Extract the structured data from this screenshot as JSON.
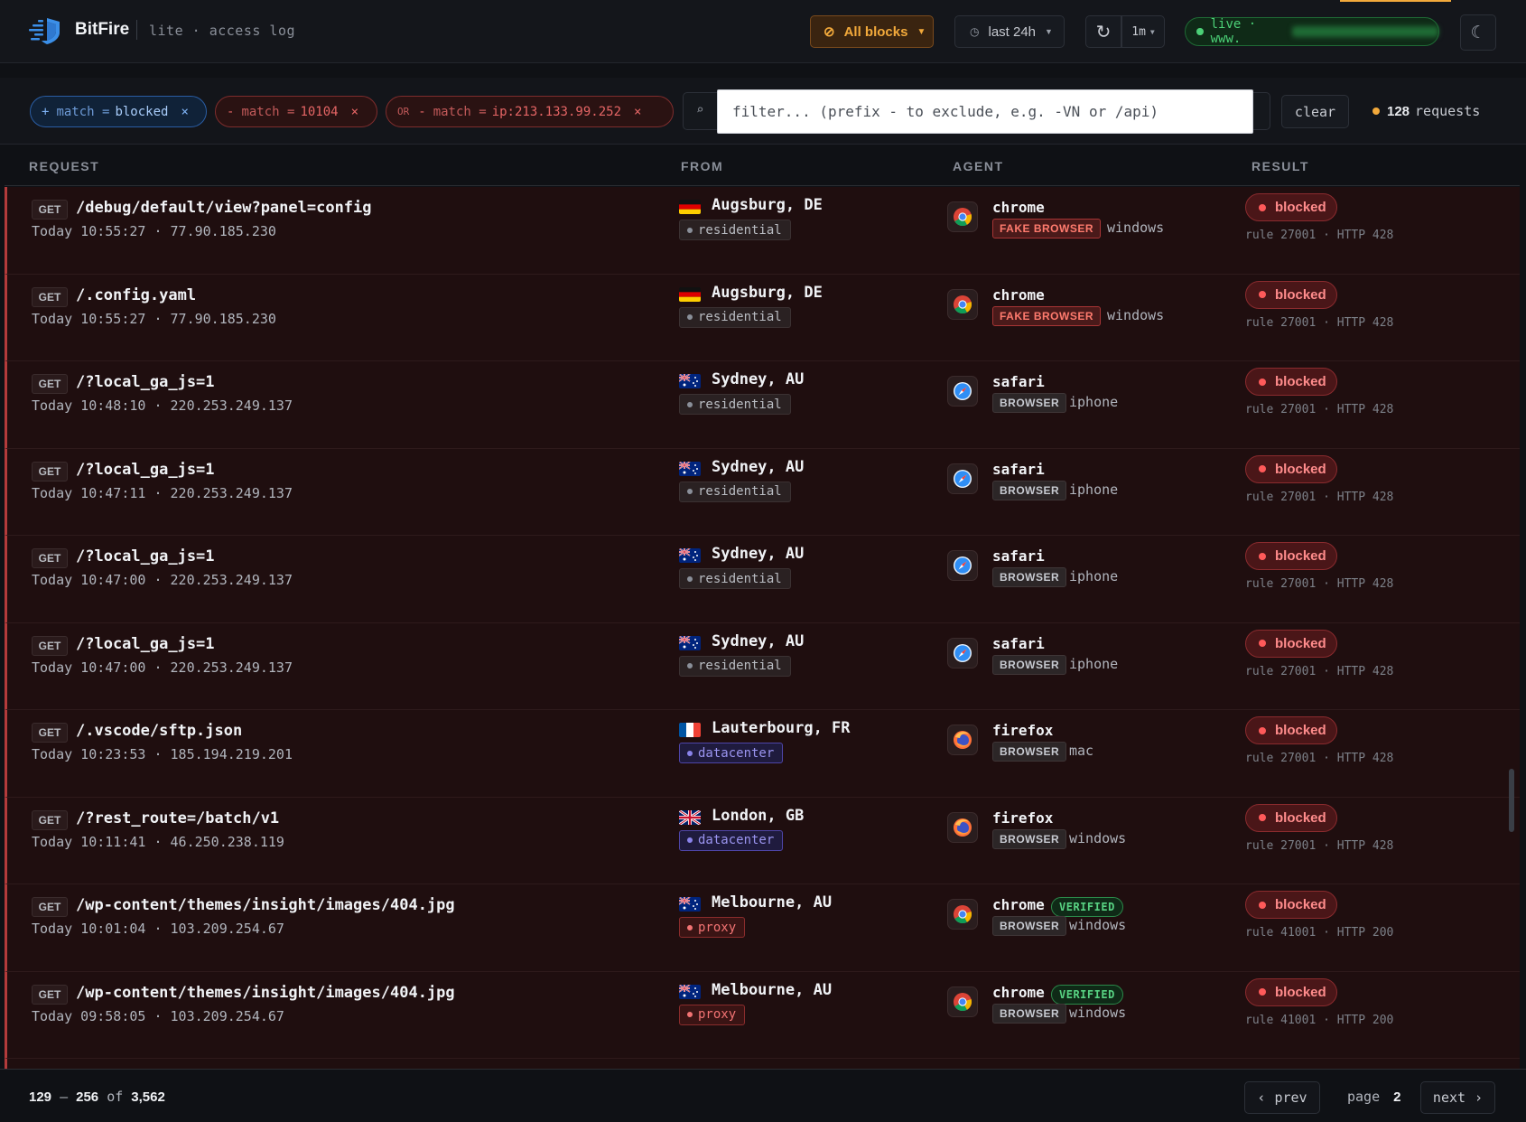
{
  "header": {
    "brand": "BitFire",
    "subtitle": "lite · access log",
    "blocks_label": "All blocks",
    "range_label": "last 24h",
    "interval_label": "1m",
    "live_label": "live · www.",
    "colors": {
      "accent": "#f2a93b",
      "live": "#4cd077",
      "blocked": "#ff5a5a"
    }
  },
  "filters": {
    "chips": [
      {
        "sign": "+",
        "key": "match =",
        "value": "blocked",
        "kind": "include"
      },
      {
        "sign": "-",
        "key": "match =",
        "value": "10104",
        "kind": "exclude"
      },
      {
        "prefix": "OR",
        "sign": "-",
        "key": "match =",
        "value": "ip:213.133.99.252",
        "kind": "exclude"
      }
    ],
    "search_placeholder": "filter... (prefix - to exclude, e.g. -VN or /api)",
    "clear_label": "clear",
    "count": "128",
    "count_label": "requests"
  },
  "table": {
    "columns": [
      "REQUEST",
      "FROM",
      "AGENT",
      "RESULT"
    ],
    "rows": [
      {
        "method": "GET",
        "path": "/debug/default/view?panel=config",
        "meta": "Today 10:55:27 · 77.90.185.230",
        "flag": "DE",
        "city": "Augsburg, DE",
        "net": "residential",
        "browser": "chrome",
        "verified": "",
        "type": "FAKE BROWSER",
        "os": "windows",
        "result": "blocked",
        "rule": "rule 27001 · HTTP 428"
      },
      {
        "method": "GET",
        "path": "/.config.yaml",
        "meta": "Today 10:55:27 · 77.90.185.230",
        "flag": "DE",
        "city": "Augsburg, DE",
        "net": "residential",
        "browser": "chrome",
        "verified": "",
        "type": "FAKE BROWSER",
        "os": "windows",
        "result": "blocked",
        "rule": "rule 27001 · HTTP 428"
      },
      {
        "method": "GET",
        "path": "/?local_ga_js=1",
        "meta": "Today 10:48:10 · 220.253.249.137",
        "flag": "AU",
        "city": "Sydney, AU",
        "net": "residential",
        "browser": "safari",
        "verified": "",
        "type": "BROWSER",
        "os": "iphone",
        "result": "blocked",
        "rule": "rule 27001 · HTTP 428"
      },
      {
        "method": "GET",
        "path": "/?local_ga_js=1",
        "meta": "Today 10:47:11 · 220.253.249.137",
        "flag": "AU",
        "city": "Sydney, AU",
        "net": "residential",
        "browser": "safari",
        "verified": "",
        "type": "BROWSER",
        "os": "iphone",
        "result": "blocked",
        "rule": "rule 27001 · HTTP 428"
      },
      {
        "method": "GET",
        "path": "/?local_ga_js=1",
        "meta": "Today 10:47:00 · 220.253.249.137",
        "flag": "AU",
        "city": "Sydney, AU",
        "net": "residential",
        "browser": "safari",
        "verified": "",
        "type": "BROWSER",
        "os": "iphone",
        "result": "blocked",
        "rule": "rule 27001 · HTTP 428"
      },
      {
        "method": "GET",
        "path": "/?local_ga_js=1",
        "meta": "Today 10:47:00 · 220.253.249.137",
        "flag": "AU",
        "city": "Sydney, AU",
        "net": "residential",
        "browser": "safari",
        "verified": "",
        "type": "BROWSER",
        "os": "iphone",
        "result": "blocked",
        "rule": "rule 27001 · HTTP 428"
      },
      {
        "method": "GET",
        "path": "/.vscode/sftp.json",
        "meta": "Today 10:23:53 · 185.194.219.201",
        "flag": "FR",
        "city": "Lauterbourg, FR",
        "net": "datacenter",
        "browser": "firefox",
        "verified": "",
        "type": "BROWSER",
        "os": "mac",
        "result": "blocked",
        "rule": "rule 27001 · HTTP 428"
      },
      {
        "method": "GET",
        "path": "/?rest_route=/batch/v1",
        "meta": "Today 10:11:41 · 46.250.238.119",
        "flag": "GB",
        "city": "London, GB",
        "net": "datacenter",
        "browser": "firefox",
        "verified": "",
        "type": "BROWSER",
        "os": "windows",
        "result": "blocked",
        "rule": "rule 27001 · HTTP 428"
      },
      {
        "method": "GET",
        "path": "/wp-content/themes/insight/images/404.jpg",
        "meta": "Today 10:01:04 · 103.209.254.67",
        "flag": "AU",
        "city": "Melbourne, AU",
        "net": "proxy",
        "browser": "chrome",
        "verified": "VERIFIED",
        "type": "BROWSER",
        "os": "windows",
        "result": "blocked",
        "rule": "rule 41001 · HTTP 200"
      },
      {
        "method": "GET",
        "path": "/wp-content/themes/insight/images/404.jpg",
        "meta": "Today 09:58:05 · 103.209.254.67",
        "flag": "AU",
        "city": "Melbourne, AU",
        "net": "proxy",
        "browser": "chrome",
        "verified": "VERIFIED",
        "type": "BROWSER",
        "os": "windows",
        "result": "blocked",
        "rule": "rule 41001 · HTTP 200"
      }
    ]
  },
  "footer": {
    "range_start": "129",
    "range_end": "256",
    "range_of": "of",
    "range_total": "3,562",
    "prev_label": "prev",
    "page_label": "page",
    "page_number": "2",
    "next_label": "next"
  }
}
